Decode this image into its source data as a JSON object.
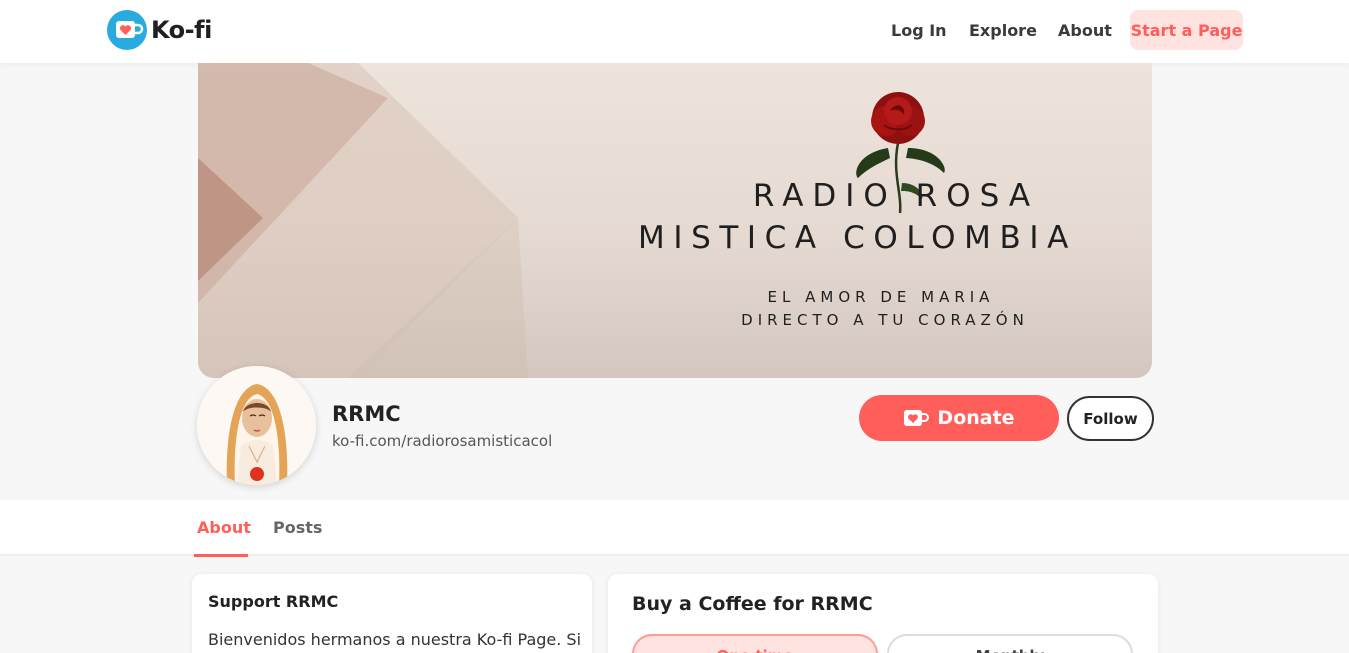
{
  "nav": {
    "logo_text": "Ko-fi",
    "links": [
      "Log In",
      "Explore",
      "About"
    ],
    "cta": "Start a Page"
  },
  "banner": {
    "line1": "RADIO ROSA",
    "line2": "MISTICA COLOMBIA",
    "line3": "EL AMOR DE MARIA",
    "line4": "DIRECTO A TU CORAZÓN"
  },
  "profile": {
    "name": "RRMC",
    "url": "ko-fi.com/radiorosamisticacol"
  },
  "actions": {
    "donate_label": "Donate",
    "follow_label": "Follow"
  },
  "tabs": [
    "About",
    "Posts"
  ],
  "support": {
    "title": "Support RRMC",
    "text": "Bienvenidos hermanos a nuestra Ko-fi Page. Si"
  },
  "coffee": {
    "title": "Buy a Coffee for RRMC",
    "options": [
      "One time",
      "Monthly"
    ]
  },
  "colors": {
    "brand": "#ff5e5b",
    "brand_light": "#ffe3e0",
    "logo_blue": "#29abe0"
  }
}
